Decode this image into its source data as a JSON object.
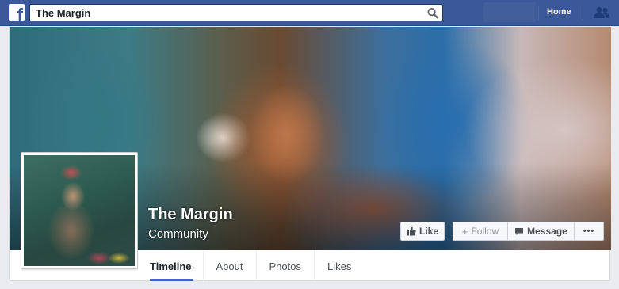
{
  "topbar": {
    "logo_letter": "f",
    "search_value": "The Margin",
    "home_label": "Home"
  },
  "page": {
    "name": "The Margin",
    "category": "Community"
  },
  "actions": {
    "like_label": "Like",
    "follow_label": "Follow",
    "message_label": "Message",
    "more_label": "•••"
  },
  "tabs": [
    {
      "label": "Timeline",
      "active": true
    },
    {
      "label": "About",
      "active": false
    },
    {
      "label": "Photos",
      "active": false
    },
    {
      "label": "Likes",
      "active": false
    }
  ],
  "colors": {
    "brand_blue": "#3b5998",
    "tab_underline": "#4267b2"
  },
  "icons": [
    "facebook-logo-icon",
    "search-icon",
    "friends-icon",
    "thumbs-up-icon",
    "plus-icon",
    "message-icon",
    "more-icon"
  ]
}
